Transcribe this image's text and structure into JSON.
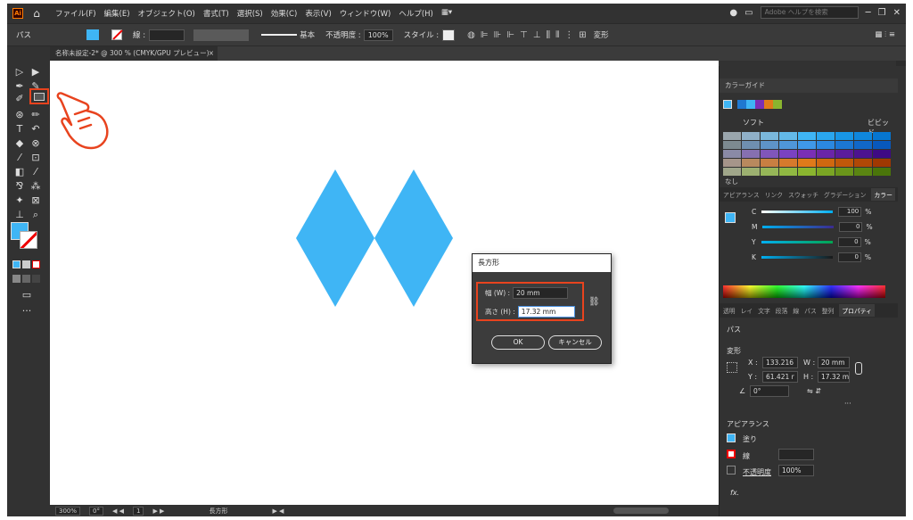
{
  "menubar": {
    "logo": "Ai",
    "items": [
      "ファイル(F)",
      "編集(E)",
      "オブジェクト(O)",
      "書式(T)",
      "選択(S)",
      "効果(C)",
      "表示(V)",
      "ウィンドウ(W)",
      "ヘルプ(H)"
    ],
    "search_placeholder": "Adobe ヘルプを検索"
  },
  "control_bar": {
    "selection_label": "パス",
    "stroke_label": "線 :",
    "stroke_style": "基本",
    "opacity_label": "不透明度 :",
    "opacity_value": "100%",
    "style_label": "スタイル :",
    "transform_label": "変形"
  },
  "document_tab": {
    "title": "名称未設定-2* @ 300 % (CMYK/GPU プレビュー)",
    "close": "×"
  },
  "dialog": {
    "title": "長方形",
    "width_label": "幅 (W) :",
    "width_value": "20 mm",
    "height_label": "高さ (H) :",
    "height_value": "17.32 mm",
    "ok_label": "OK",
    "cancel_label": "キャンセル"
  },
  "status_bar": {
    "zoom": "300%",
    "rotation": "0°",
    "artboard": "1",
    "tool": "長方形"
  },
  "color_guide": {
    "title": "カラーガイド",
    "soft_label": "ソフト",
    "vivid_label": "ビビッド",
    "none_label": "なし"
  },
  "color_panel": {
    "tabs": [
      "アピアランス",
      "リンク",
      "スウォッチ",
      "グラデーション",
      "カラー"
    ],
    "channels": [
      {
        "label": "C",
        "value": "100",
        "unit": "%"
      },
      {
        "label": "M",
        "value": "0",
        "unit": "%"
      },
      {
        "label": "Y",
        "value": "0",
        "unit": "%"
      },
      {
        "label": "K",
        "value": "0",
        "unit": "%"
      }
    ]
  },
  "properties_panel": {
    "tabs": [
      "透明",
      "レイ",
      "文字",
      "段落",
      "線",
      "パス",
      "整列",
      "プロパティ"
    ],
    "section_path": "パス",
    "transform_label": "変形",
    "x_label": "X :",
    "x_value": "133.216",
    "y_label": "Y :",
    "y_value": "61.421 r",
    "w_label": "W :",
    "w_value": "20 mm",
    "h_label": "H :",
    "h_value": "17.32 m",
    "angle_value": "0°",
    "appearance_title": "アピアランス",
    "fill_label": "塗り",
    "stroke_label": "線",
    "opacity_label": "不透明度",
    "opacity_value": "100%",
    "fx_label": "fx."
  },
  "colors": {
    "accent_blue": "#3fb5f5",
    "highlight_red": "#e8431e"
  }
}
